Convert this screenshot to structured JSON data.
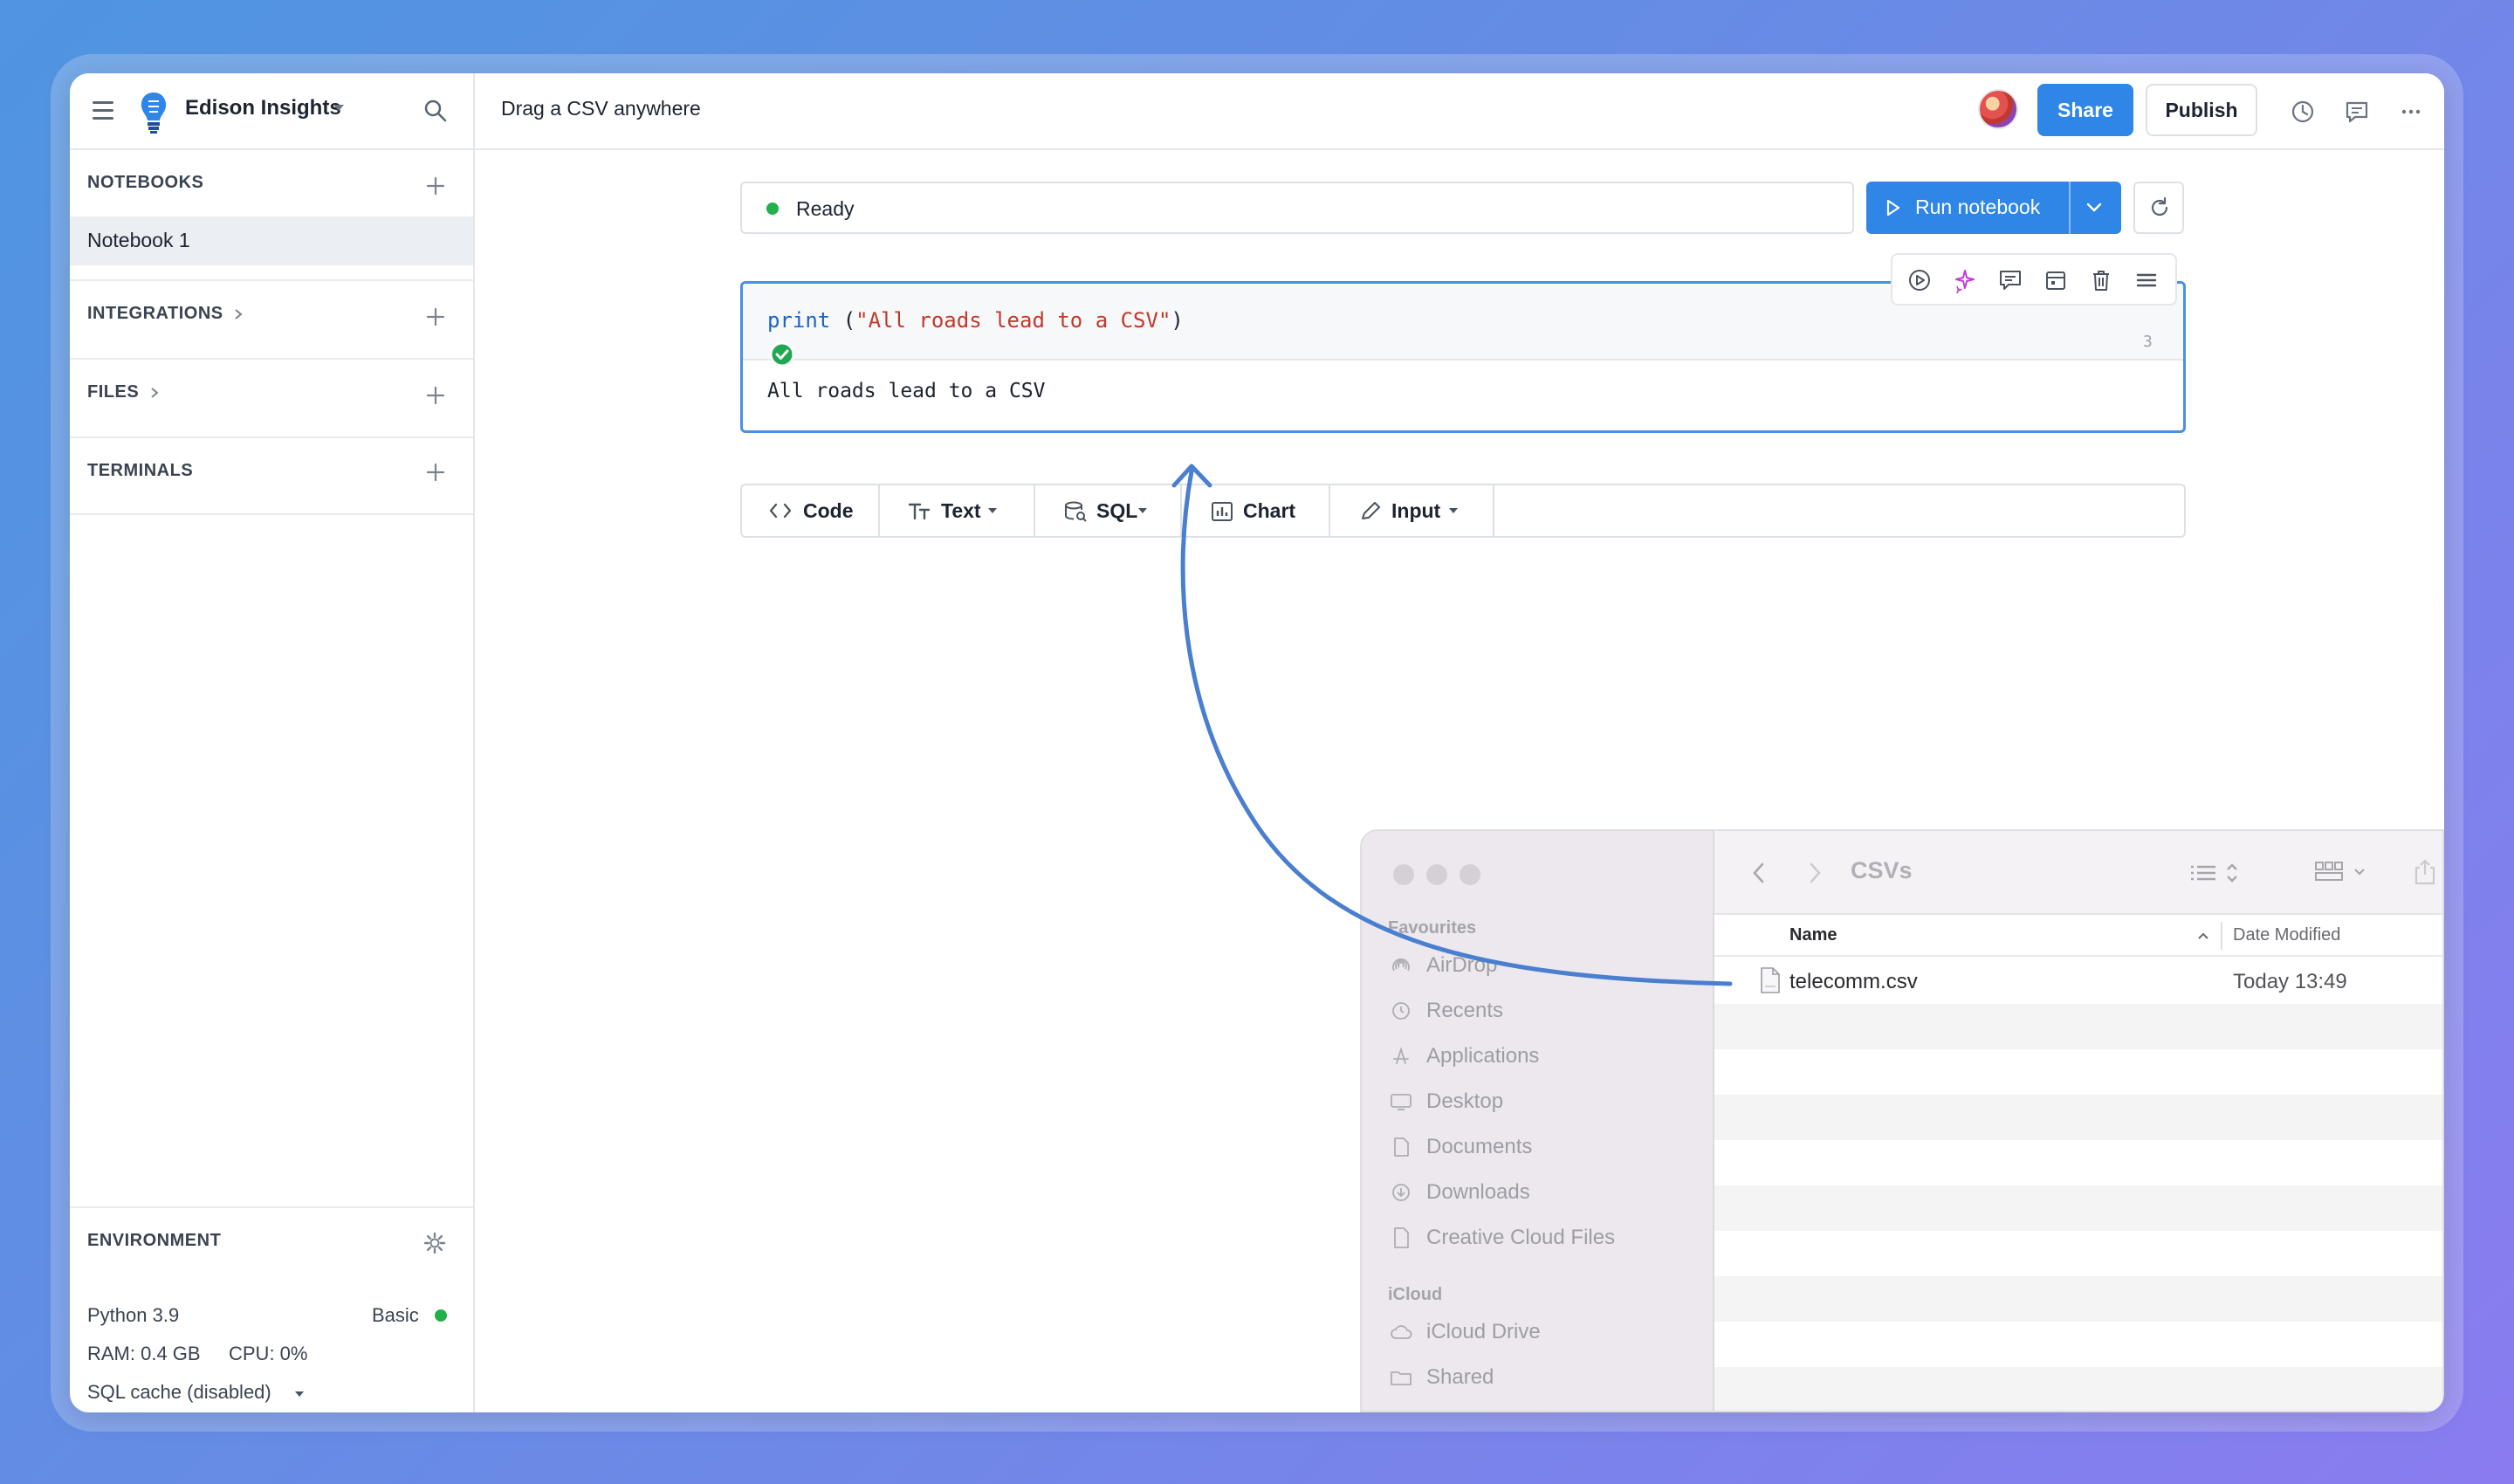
{
  "app": {
    "workspace_name": "Edison Insights",
    "page_title": "Drag a CSV anywhere",
    "share_label": "Share",
    "publish_label": "Publish"
  },
  "sidebar": {
    "sections": {
      "notebooks": "NOTEBOOKS",
      "integrations": "INTEGRATIONS",
      "files": "FILES",
      "terminals": "TERMINALS"
    },
    "notebooks": [
      {
        "label": "Notebook 1",
        "selected": true
      }
    ],
    "environment": {
      "heading": "ENVIRONMENT",
      "python": "Python 3.9",
      "tier": "Basic",
      "ram": "RAM: 0.4 GB",
      "cpu": "CPU: 0%",
      "sql_cache": "SQL cache (disabled)"
    }
  },
  "notebook": {
    "status": "Ready",
    "run_label": "Run notebook",
    "cell": {
      "code_keyword": "print",
      "code_open": " (",
      "code_string": "\"All roads lead to a CSV\"",
      "code_close": ")",
      "line_number": "3",
      "output": "All roads lead to a CSV"
    },
    "add_cell_buttons": [
      {
        "label": "Code",
        "icon": "code-icon",
        "has_caret": false
      },
      {
        "label": "Text",
        "icon": "text-icon",
        "has_caret": true
      },
      {
        "label": "SQL",
        "icon": "sql-icon",
        "has_caret": true
      },
      {
        "label": "Chart",
        "icon": "chart-icon",
        "has_caret": false
      },
      {
        "label": "Input",
        "icon": "pencil-icon",
        "has_caret": true
      }
    ]
  },
  "finder": {
    "folder_title": "CSVs",
    "sidebar_heading_favourites": "Favourites",
    "favourites": [
      "AirDrop",
      "Recents",
      "Applications",
      "Desktop",
      "Documents",
      "Downloads",
      "Creative Cloud Files"
    ],
    "sidebar_heading_icloud": "iCloud",
    "icloud": [
      "iCloud Drive",
      "Shared"
    ],
    "columns": {
      "name": "Name",
      "date": "Date Modified"
    },
    "files": [
      {
        "name": "telecomm.csv",
        "date": "Today 13:49"
      }
    ]
  },
  "colors": {
    "accent": "#2f86e6",
    "status_ok": "#22b04b",
    "arrow": "#4a7fcf"
  }
}
